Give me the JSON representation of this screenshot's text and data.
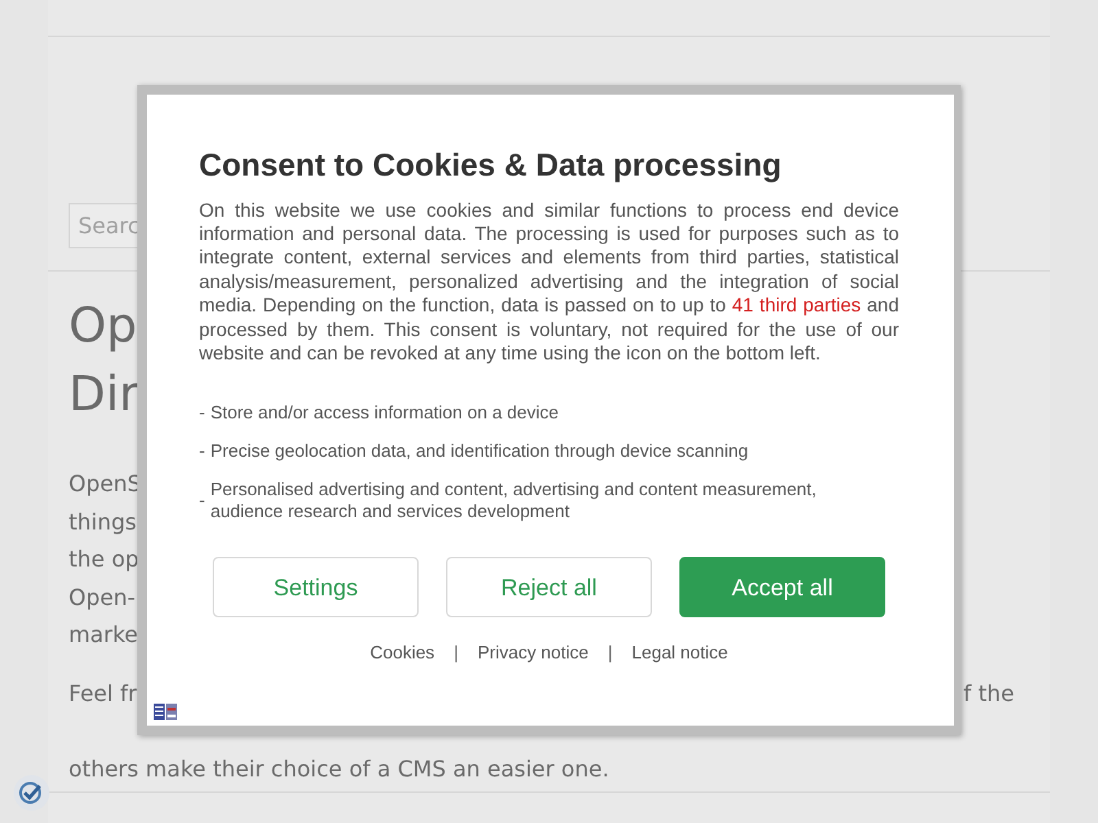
{
  "page": {
    "search": {
      "placeholder": "Searc"
    },
    "heading_lines": [
      {
        "left": "Op"
      },
      {
        "left": "Dir"
      }
    ],
    "paragraphs": [
      {
        "lines": [
          {
            "left": "OpenS"
          },
          {
            "left": "things"
          },
          {
            "left": "the op"
          },
          {
            "left": "Open-"
          },
          {
            "left": "marke"
          }
        ]
      },
      {
        "lines": [
          {
            "left": "Feel fr",
            "right": "f the"
          },
          {
            "left": "others make their choice of a CMS an easier one."
          }
        ]
      }
    ]
  },
  "dialog": {
    "title": "Consent to Cookies & Data processing",
    "intro_before": "On this website we use cookies and similar functions to process end device information and personal data. The processing is used for purposes such as to integrate content, external services and elements from third parties, statistical analysis/measurement, personalized advertising and the integration of social media. Depending on the function, data is passed on to up to",
    "intro_link": "41 third parties",
    "intro_after": "and processed by them. This consent is voluntary, not required for the use of our website and can be revoked at any time using the icon on the bottom left.",
    "purposes": [
      {
        "bullet": "-",
        "text": "Store and/or access information on a device"
      },
      {
        "bullet": "-",
        "text": "Precise geolocation data, and identification through device scanning"
      },
      {
        "bullet": "-",
        "text": "Personalised advertising and content, advertising and content measurement, audience research and services development"
      }
    ],
    "buttons": [
      {
        "label": "Settings",
        "kind": "outline"
      },
      {
        "label": "Reject all",
        "kind": "outline"
      },
      {
        "label": "Accept all",
        "kind": "primary"
      }
    ],
    "links": [
      {
        "label": "Cookies"
      },
      {
        "label": "Privacy notice"
      },
      {
        "label": "Legal notice"
      }
    ],
    "separator": "|"
  }
}
